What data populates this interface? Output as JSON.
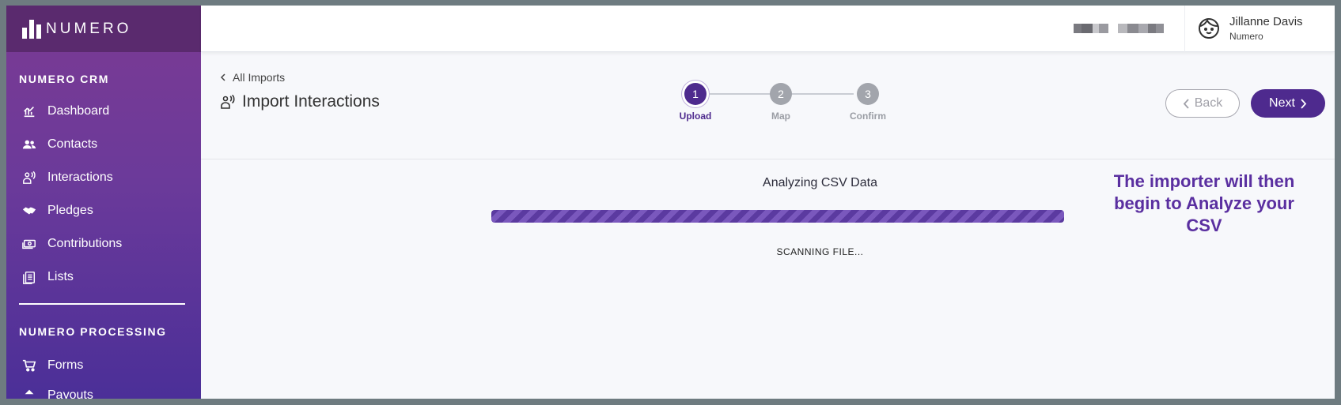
{
  "brand": {
    "name": "NUMERO"
  },
  "sidebar": {
    "section1_title": "NUMERO CRM",
    "items": [
      {
        "label": "Dashboard",
        "icon": "chart-icon"
      },
      {
        "label": "Contacts",
        "icon": "users-icon"
      },
      {
        "label": "Interactions",
        "icon": "interactions-icon"
      },
      {
        "label": "Pledges",
        "icon": "handshake-icon"
      },
      {
        "label": "Contributions",
        "icon": "money-icon"
      },
      {
        "label": "Lists",
        "icon": "list-icon"
      }
    ],
    "section2_title": "NUMERO PROCESSING",
    "items2": [
      {
        "label": "Forms",
        "icon": "cart-icon"
      },
      {
        "label": "Payouts",
        "icon": "payouts-icon"
      }
    ]
  },
  "topbar": {
    "user_name": "Jillanne Davis",
    "user_org": "Numero"
  },
  "header": {
    "back_label": "All Imports",
    "title": "Import Interactions",
    "steps": [
      {
        "number": "1",
        "label": "Upload"
      },
      {
        "number": "2",
        "label": "Map"
      },
      {
        "number": "3",
        "label": "Confirm"
      }
    ],
    "back_button": "Back",
    "next_button": "Next"
  },
  "content": {
    "analyze_title": "Analyzing CSV Data",
    "scan_text": "SCANNING FILE...",
    "annotation": "The importer will then begin to Analyze your CSV"
  },
  "colors": {
    "accent": "#4e2a8e",
    "annotation": "#5a2fa0"
  }
}
